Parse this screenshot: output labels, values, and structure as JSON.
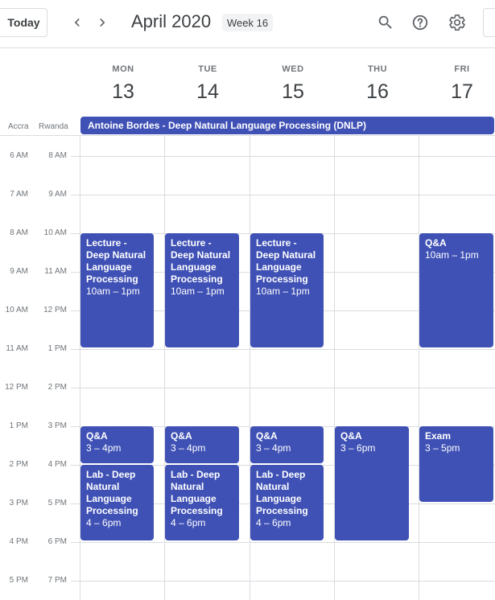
{
  "header": {
    "today_label": "Today",
    "month_title": "April 2020",
    "week_badge": "Week 16"
  },
  "timezones": [
    "Accra",
    "Rwanda"
  ],
  "days": [
    {
      "name": "MON",
      "num": "13"
    },
    {
      "name": "TUE",
      "num": "14"
    },
    {
      "name": "WED",
      "num": "15"
    },
    {
      "name": "THU",
      "num": "16"
    },
    {
      "name": "FRI",
      "num": "17"
    }
  ],
  "allday_event": "Antoine Bordes - Deep Natural Language Processing (DNLP)",
  "times_accra": [
    "6 AM",
    "7 AM",
    "8 AM",
    "9 AM",
    "10 AM",
    "11 AM",
    "12 PM",
    "1 PM",
    "2 PM",
    "3 PM",
    "4 PM",
    "5 PM"
  ],
  "times_rwanda": [
    "8 AM",
    "9 AM",
    "10 AM",
    "11 AM",
    "12 PM",
    "1 PM",
    "2 PM",
    "3 PM",
    "4 PM",
    "5 PM",
    "6 PM",
    "7 PM"
  ],
  "events": {
    "mon_lecture": {
      "title": "Lecture - Deep Natural Language Processing",
      "time": "10am – 1pm"
    },
    "tue_lecture": {
      "title": "Lecture - Deep Natural Language Processing",
      "time": "10am – 1pm"
    },
    "wed_lecture": {
      "title": "Lecture - Deep Natural Language Processing",
      "time": "10am – 1pm"
    },
    "fri_qa": {
      "title": "Q&A",
      "time": "10am – 1pm"
    },
    "mon_qa": {
      "title": "Q&A",
      "time": "3 – 4pm"
    },
    "tue_qa": {
      "title": "Q&A",
      "time": "3 – 4pm"
    },
    "wed_qa": {
      "title": "Q&A",
      "time": "3 – 4pm"
    },
    "thu_qa": {
      "title": "Q&A",
      "time": "3 – 6pm"
    },
    "fri_exam": {
      "title": "Exam",
      "time": "3 – 5pm"
    },
    "mon_lab": {
      "title": "Lab - Deep Natural Language Processing",
      "time": "4 – 6pm"
    },
    "tue_lab": {
      "title": "Lab - Deep Natural Language Processing",
      "time": "4 – 6pm"
    },
    "wed_lab": {
      "title": "Lab - Deep Natural Language Processing",
      "time": "4 – 6pm"
    }
  },
  "colors": {
    "event": "#3f51b5",
    "grid": "#dadce0"
  },
  "icons": [
    "chevron-left-icon",
    "chevron-right-icon",
    "search-icon",
    "help-icon",
    "settings-icon"
  ]
}
